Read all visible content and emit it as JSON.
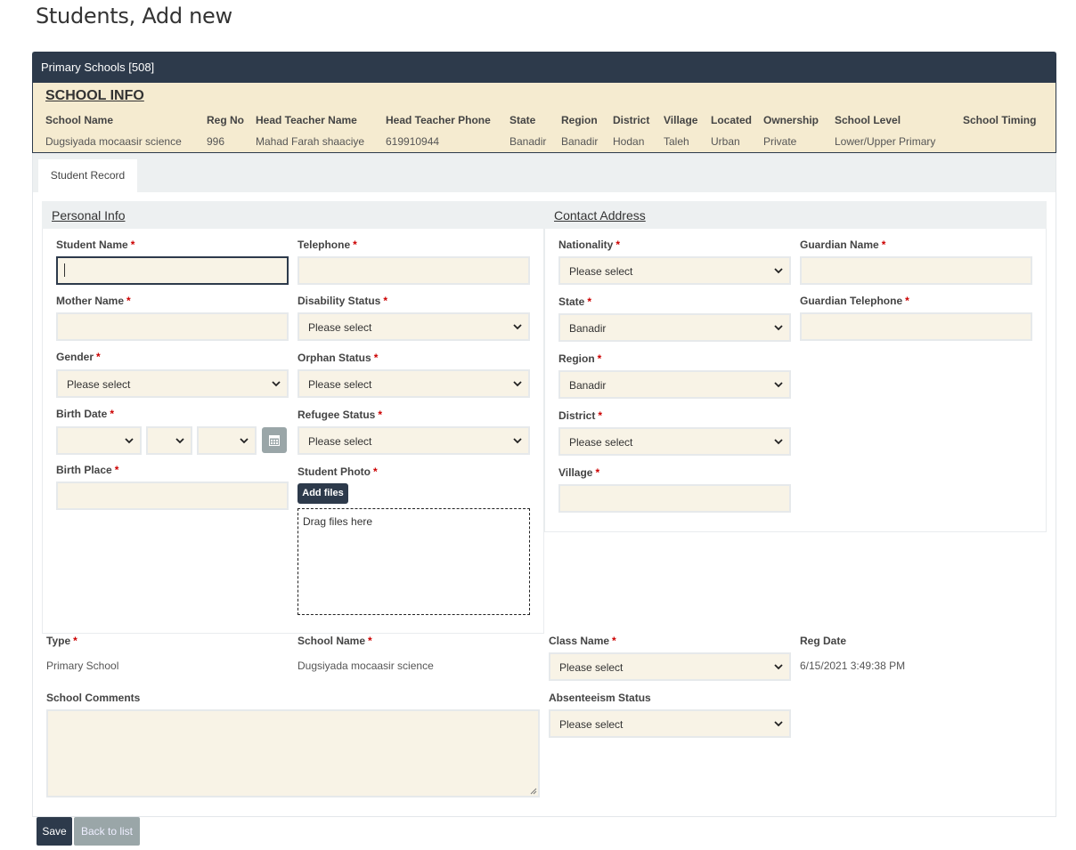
{
  "page": {
    "title": "Students, Add new"
  },
  "panel": {
    "header": "Primary Schools [508]"
  },
  "school_info": {
    "title": "SCHOOL INFO",
    "columns": [
      "School Name",
      "Reg No",
      "Head Teacher Name",
      "Head Teacher Phone",
      "State",
      "Region",
      "District",
      "Village",
      "Located",
      "Ownership",
      "School Level",
      "School Timing"
    ],
    "values": [
      "Dugsiyada mocaasir science",
      "996",
      "Mahad Farah shaaciye",
      "619910944",
      "Banadir",
      "Banadir",
      "Hodan",
      "Taleh",
      "Urban",
      "Private",
      "Lower/Upper Primary",
      ""
    ]
  },
  "tabs": [
    {
      "label": "Student Record"
    }
  ],
  "personal_info": {
    "title": "Personal Info",
    "student_name": {
      "label": "Student Name",
      "value": ""
    },
    "telephone": {
      "label": "Telephone",
      "value": ""
    },
    "mother_name": {
      "label": "Mother Name",
      "value": ""
    },
    "disability_status": {
      "label": "Disability Status",
      "selected": "Please select"
    },
    "gender": {
      "label": "Gender",
      "selected": "Please select"
    },
    "orphan_status": {
      "label": "Orphan Status",
      "selected": "Please select"
    },
    "birth_date": {
      "label": "Birth Date",
      "day": "",
      "month": "",
      "year": ""
    },
    "refugee_status": {
      "label": "Refugee Status",
      "selected": "Please select"
    },
    "birth_place": {
      "label": "Birth Place",
      "value": ""
    },
    "student_photo": {
      "label": "Student Photo",
      "add_files": "Add files",
      "drop_text": "Drag files here"
    }
  },
  "contact_address": {
    "title": "Contact Address",
    "nationality": {
      "label": "Nationality",
      "selected": "Please select"
    },
    "guardian_name": {
      "label": "Guardian Name",
      "value": ""
    },
    "state": {
      "label": "State",
      "selected": "Banadir"
    },
    "guardian_telephone": {
      "label": "Guardian Telephone",
      "value": ""
    },
    "region": {
      "label": "Region",
      "selected": "Banadir"
    },
    "district": {
      "label": "District",
      "selected": "Please select"
    },
    "village": {
      "label": "Village",
      "value": ""
    }
  },
  "enrollment": {
    "type": {
      "label": "Type",
      "value": "Primary School"
    },
    "school_name": {
      "label": "School Name",
      "value": "Dugsiyada mocaasir science"
    },
    "class_name": {
      "label": "Class Name",
      "selected": "Please select"
    },
    "reg_date": {
      "label": "Reg Date",
      "value": "6/15/2021 3:49:38 PM"
    },
    "school_comments": {
      "label": "School Comments",
      "value": ""
    },
    "absenteeism_status": {
      "label": "Absenteeism Status",
      "selected": "Please select"
    }
  },
  "actions": {
    "save": "Save",
    "back": "Back to list"
  },
  "required_marker": "*",
  "colors": {
    "header": "#2d3a4b",
    "school_info_bg": "#f5ebd0",
    "input_bg": "#f8f3e6",
    "required": "#cc0000",
    "secondary_button": "#9aa6a8"
  }
}
